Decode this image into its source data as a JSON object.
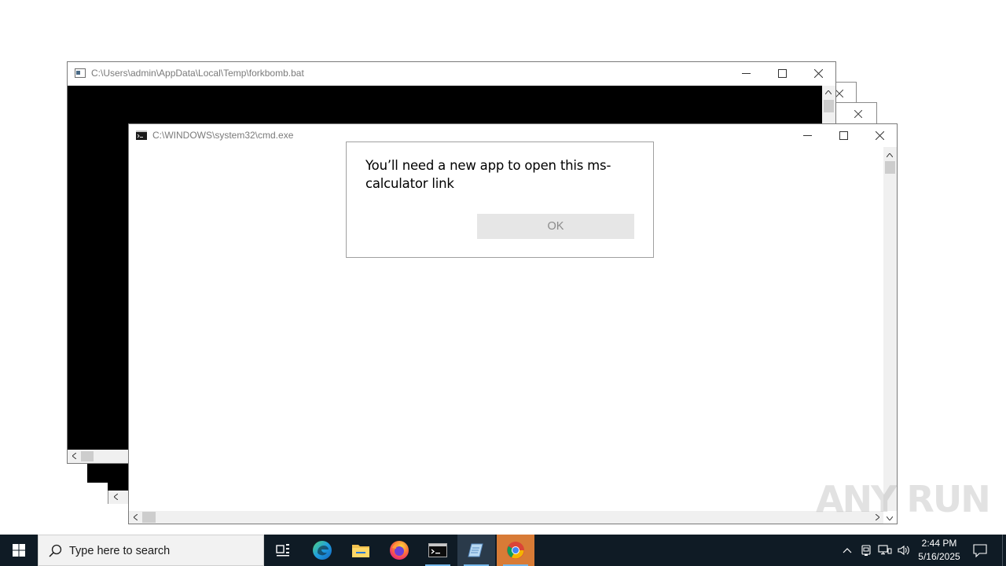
{
  "windows": {
    "forkbomb": {
      "title": "C:\\Users\\admin\\AppData\\Local\\Temp\\forkbomb.bat"
    },
    "cmd": {
      "title": "C:\\WINDOWS\\system32\\cmd.exe"
    }
  },
  "dialog": {
    "message": "You’ll need a new app to open this ms-calculator link",
    "ok_label": "OK"
  },
  "taskbar": {
    "search_placeholder": "Type here to search",
    "apps": [
      "task-view",
      "edge",
      "file-explorer",
      "firefox",
      "cmd",
      "notepad",
      "chrome"
    ],
    "time": "2:44 PM",
    "date": "5/16/2025"
  },
  "watermark": "ANY RUN",
  "colors": {
    "taskbar": "#0f1b25",
    "console": "#000000",
    "accent": "#76b9ed",
    "chrome_active_bg": "#d87b36"
  }
}
